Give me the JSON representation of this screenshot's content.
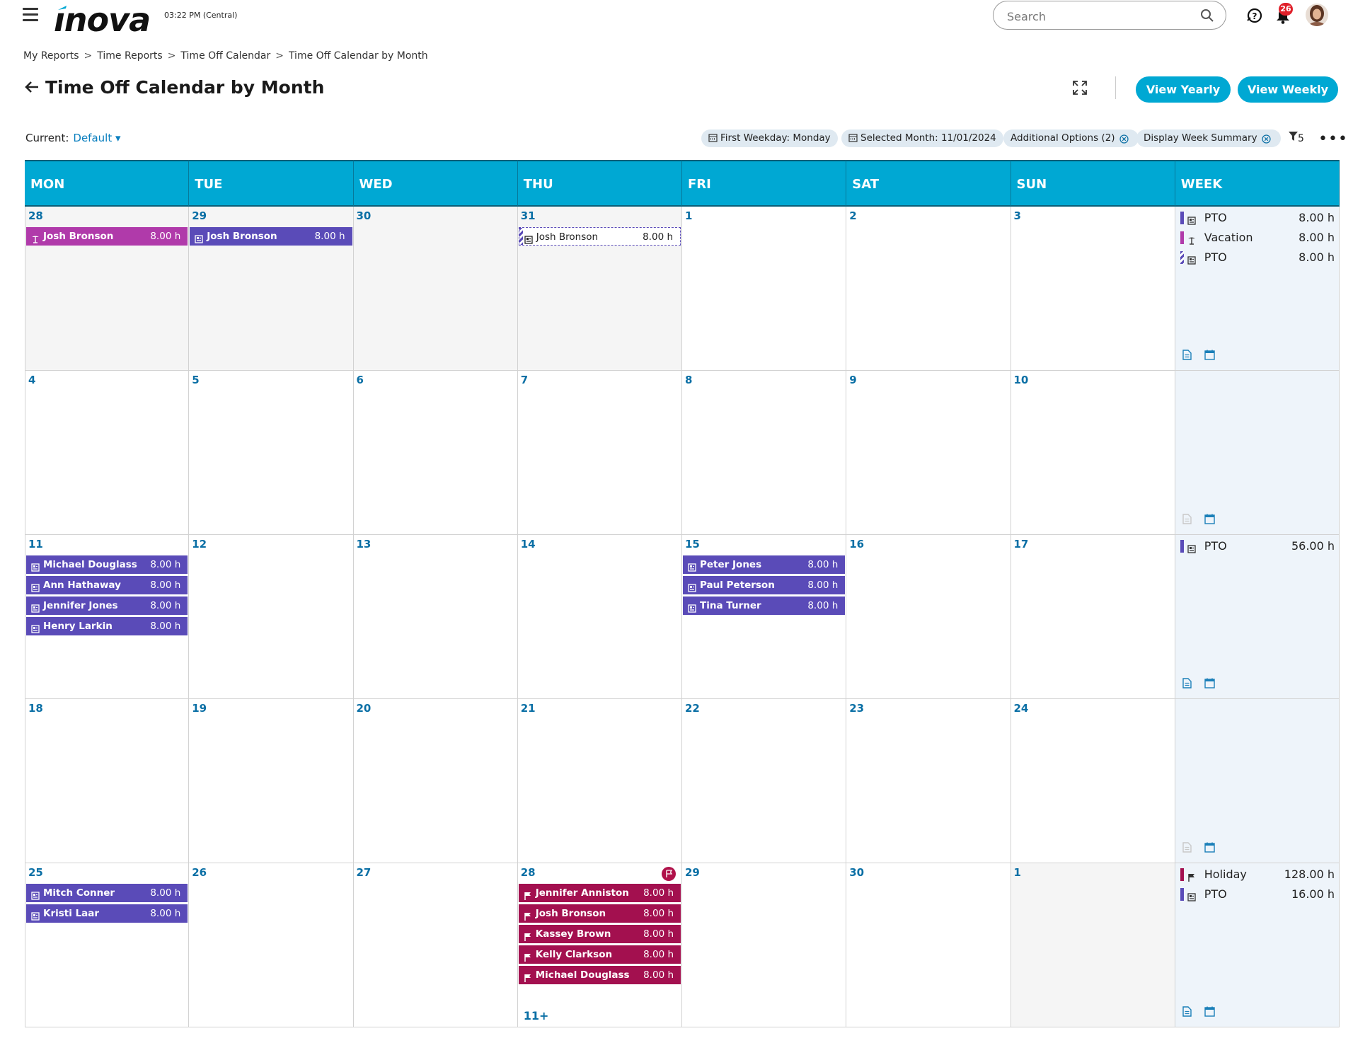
{
  "header": {
    "logo_text": "INOVA",
    "clock": "03:22 PM (Central)",
    "search_placeholder": "Search",
    "notification_count": "26"
  },
  "breadcrumb": [
    "My Reports",
    "Time Reports",
    "Time Off Calendar",
    "Time Off Calendar by Month"
  ],
  "page": {
    "title": "Time Off Calendar by Month",
    "view_yearly": "View Yearly",
    "view_weekly": "View Weekly"
  },
  "filters": {
    "current_label": "Current:",
    "current_value": "Default",
    "chips": [
      "First Weekday: Monday",
      "Selected Month: 11/01/2024",
      "Additional Options (2)",
      "Display Week Summary"
    ],
    "filter_count": "5"
  },
  "colors": {
    "accent": "#00a8d3",
    "pto": "#5a4bb8",
    "vacation": "#b03aaa",
    "holiday": "#a3104f"
  },
  "calendar": {
    "headers": [
      "MON",
      "TUE",
      "WED",
      "THU",
      "FRI",
      "SAT",
      "SUN",
      "WEEK"
    ],
    "weeks": [
      {
        "days": [
          {
            "num": "28",
            "out": true,
            "events": [
              {
                "name": "Josh Bronson",
                "hours": "8.00 h",
                "type": "vacation"
              }
            ]
          },
          {
            "num": "29",
            "out": true,
            "events": [
              {
                "name": "Josh Bronson",
                "hours": "8.00 h",
                "type": "pto"
              }
            ]
          },
          {
            "num": "30",
            "out": true,
            "events": []
          },
          {
            "num": "31",
            "out": true,
            "events": [
              {
                "name": "Josh Bronson",
                "hours": "8.00 h",
                "type": "pending"
              }
            ]
          },
          {
            "num": "1",
            "out": false,
            "events": []
          },
          {
            "num": "2",
            "out": false,
            "events": []
          },
          {
            "num": "3",
            "out": false,
            "events": []
          }
        ],
        "summary": [
          {
            "label": "PTO",
            "hours": "8.00 h",
            "type": "pto"
          },
          {
            "label": "Vacation",
            "hours": "8.00 h",
            "type": "vacation"
          },
          {
            "label": "PTO",
            "hours": "8.00 h",
            "type": "pending"
          }
        ],
        "has_report": true
      },
      {
        "days": [
          {
            "num": "4",
            "out": false,
            "events": []
          },
          {
            "num": "5",
            "out": false,
            "events": []
          },
          {
            "num": "6",
            "out": false,
            "events": []
          },
          {
            "num": "7",
            "out": false,
            "events": []
          },
          {
            "num": "8",
            "out": false,
            "events": []
          },
          {
            "num": "9",
            "out": false,
            "events": []
          },
          {
            "num": "10",
            "out": false,
            "events": []
          }
        ],
        "summary": [],
        "has_report": false
      },
      {
        "days": [
          {
            "num": "11",
            "out": false,
            "events": [
              {
                "name": "Michael Douglass",
                "hours": "8.00 h",
                "type": "pto"
              },
              {
                "name": "Ann Hathaway",
                "hours": "8.00 h",
                "type": "pto"
              },
              {
                "name": "Jennifer Jones",
                "hours": "8.00 h",
                "type": "pto"
              },
              {
                "name": "Henry Larkin",
                "hours": "8.00 h",
                "type": "pto"
              }
            ]
          },
          {
            "num": "12",
            "out": false,
            "events": []
          },
          {
            "num": "13",
            "out": false,
            "events": []
          },
          {
            "num": "14",
            "out": false,
            "events": []
          },
          {
            "num": "15",
            "out": false,
            "events": [
              {
                "name": "Peter Jones",
                "hours": "8.00 h",
                "type": "pto"
              },
              {
                "name": "Paul Peterson",
                "hours": "8.00 h",
                "type": "pto"
              },
              {
                "name": "Tina Turner",
                "hours": "8.00 h",
                "type": "pto"
              }
            ]
          },
          {
            "num": "16",
            "out": false,
            "events": []
          },
          {
            "num": "17",
            "out": false,
            "events": []
          }
        ],
        "summary": [
          {
            "label": "PTO",
            "hours": "56.00 h",
            "type": "pto"
          }
        ],
        "has_report": true
      },
      {
        "days": [
          {
            "num": "18",
            "out": false,
            "events": []
          },
          {
            "num": "19",
            "out": false,
            "events": []
          },
          {
            "num": "20",
            "out": false,
            "events": []
          },
          {
            "num": "21",
            "out": false,
            "events": []
          },
          {
            "num": "22",
            "out": false,
            "events": []
          },
          {
            "num": "23",
            "out": false,
            "events": []
          },
          {
            "num": "24",
            "out": false,
            "events": []
          }
        ],
        "summary": [],
        "has_report": false
      },
      {
        "days": [
          {
            "num": "25",
            "out": false,
            "events": [
              {
                "name": "Mitch Conner",
                "hours": "8.00 h",
                "type": "pto"
              },
              {
                "name": "Kristi Laar",
                "hours": "8.00 h",
                "type": "pto"
              }
            ]
          },
          {
            "num": "26",
            "out": false,
            "events": []
          },
          {
            "num": "27",
            "out": false,
            "events": []
          },
          {
            "num": "28",
            "out": false,
            "holiday_flag": true,
            "more": "11+",
            "events": [
              {
                "name": "Jennifer Anniston",
                "hours": "8.00 h",
                "type": "holiday"
              },
              {
                "name": "Josh Bronson",
                "hours": "8.00 h",
                "type": "holiday"
              },
              {
                "name": "Kassey Brown",
                "hours": "8.00 h",
                "type": "holiday"
              },
              {
                "name": "Kelly Clarkson",
                "hours": "8.00 h",
                "type": "holiday"
              },
              {
                "name": "Michael Douglass",
                "hours": "8.00 h",
                "type": "holiday"
              }
            ]
          },
          {
            "num": "29",
            "out": false,
            "events": []
          },
          {
            "num": "30",
            "out": false,
            "events": []
          },
          {
            "num": "1",
            "out": true,
            "events": []
          }
        ],
        "summary": [
          {
            "label": "Holiday",
            "hours": "128.00 h",
            "type": "holiday"
          },
          {
            "label": "PTO",
            "hours": "16.00 h",
            "type": "pto"
          }
        ],
        "has_report": true
      }
    ]
  }
}
